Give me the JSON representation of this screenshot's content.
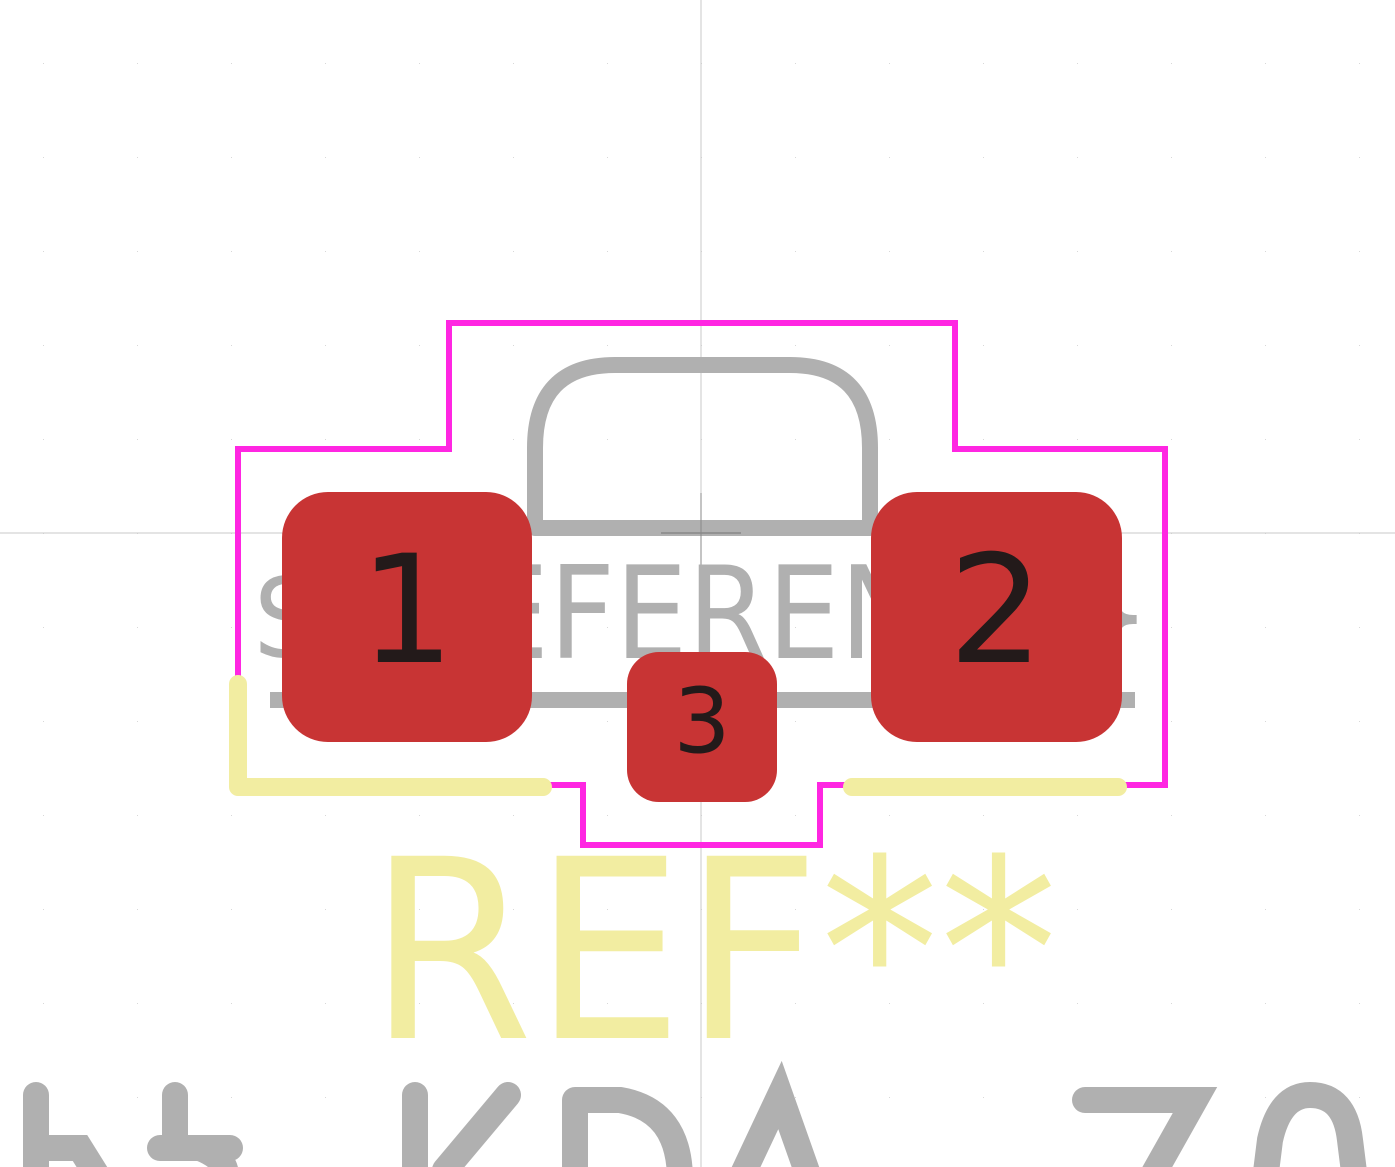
{
  "canvas": {
    "background": "#ffffff",
    "crosshair_color": "#c8c8c8",
    "grid_color": "#d8d8d8"
  },
  "footprint": {
    "reference_text": "REF**",
    "fab_reference_text": "${REFERENCE}",
    "pads": [
      {
        "number": "1"
      },
      {
        "number": "2"
      },
      {
        "number": "3"
      }
    ]
  },
  "colors": {
    "pad": "#c83434",
    "pad_number": "#231a1a",
    "courtyard": "#ff26e2",
    "silkscreen": "#f2eda1",
    "fab": "#b0b0b0"
  }
}
